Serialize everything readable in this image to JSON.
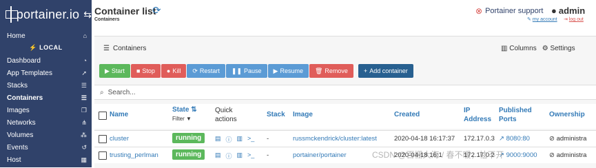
{
  "brand": {
    "name": "portainer.io"
  },
  "sidebar": {
    "home": "Home",
    "endpoint": "LOCAL",
    "items": [
      {
        "label": "Dashboard",
        "icon": "tachometer-icon"
      },
      {
        "label": "App Templates",
        "icon": "rocket-icon"
      },
      {
        "label": "Stacks",
        "icon": "list-icon"
      },
      {
        "label": "Containers",
        "icon": "server-icon"
      },
      {
        "label": "Images",
        "icon": "clone-icon"
      },
      {
        "label": "Networks",
        "icon": "sitemap-icon"
      },
      {
        "label": "Volumes",
        "icon": "cubes-icon"
      },
      {
        "label": "Events",
        "icon": "history-icon"
      },
      {
        "label": "Host",
        "icon": "th-icon"
      }
    ]
  },
  "header": {
    "title": "Container list",
    "breadcrumb": "Containers",
    "support": "Portainer support",
    "user": "admin",
    "my_account": "my account",
    "log_out": "log out"
  },
  "panel": {
    "title": "Containers",
    "columns_label": "Columns",
    "settings_label": "Settings",
    "search_placeholder": "Search..."
  },
  "toolbar": {
    "start": "Start",
    "stop": "Stop",
    "kill": "Kill",
    "restart": "Restart",
    "pause": "Pause",
    "resume": "Resume",
    "remove": "Remove",
    "add": "Add container"
  },
  "table": {
    "headers": {
      "name": "Name",
      "state": "State",
      "filter": "Filter",
      "quick1": "Quick",
      "quick2": "actions",
      "stack": "Stack",
      "image": "Image",
      "created": "Created",
      "ip1": "IP",
      "ip2": "Address",
      "ports1": "Published",
      "ports2": "Ports",
      "ownership": "Ownership"
    },
    "rows": [
      {
        "name": "cluster",
        "state": "running",
        "stack": "-",
        "image": "russmckendrick/cluster:latest",
        "created": "2020-04-18 16:17:37",
        "ip": "172.17.0.3",
        "ports": "8080:80",
        "ownership": "administra"
      },
      {
        "name": "trusting_perlman",
        "state": "running",
        "stack": "-",
        "image": "portainer/portainer",
        "created": "2020-04-18 16:1",
        "ip": "172.17.0.2",
        "ports": "9000:9000",
        "ownership": "administra"
      }
    ]
  },
  "watermark": "CSDN @百栅大海 / 春不暖，枯不开",
  "colors": {
    "sidebar": "#30426a",
    "link": "#337ab7",
    "running": "#5cb85c",
    "danger": "#d9534f"
  }
}
